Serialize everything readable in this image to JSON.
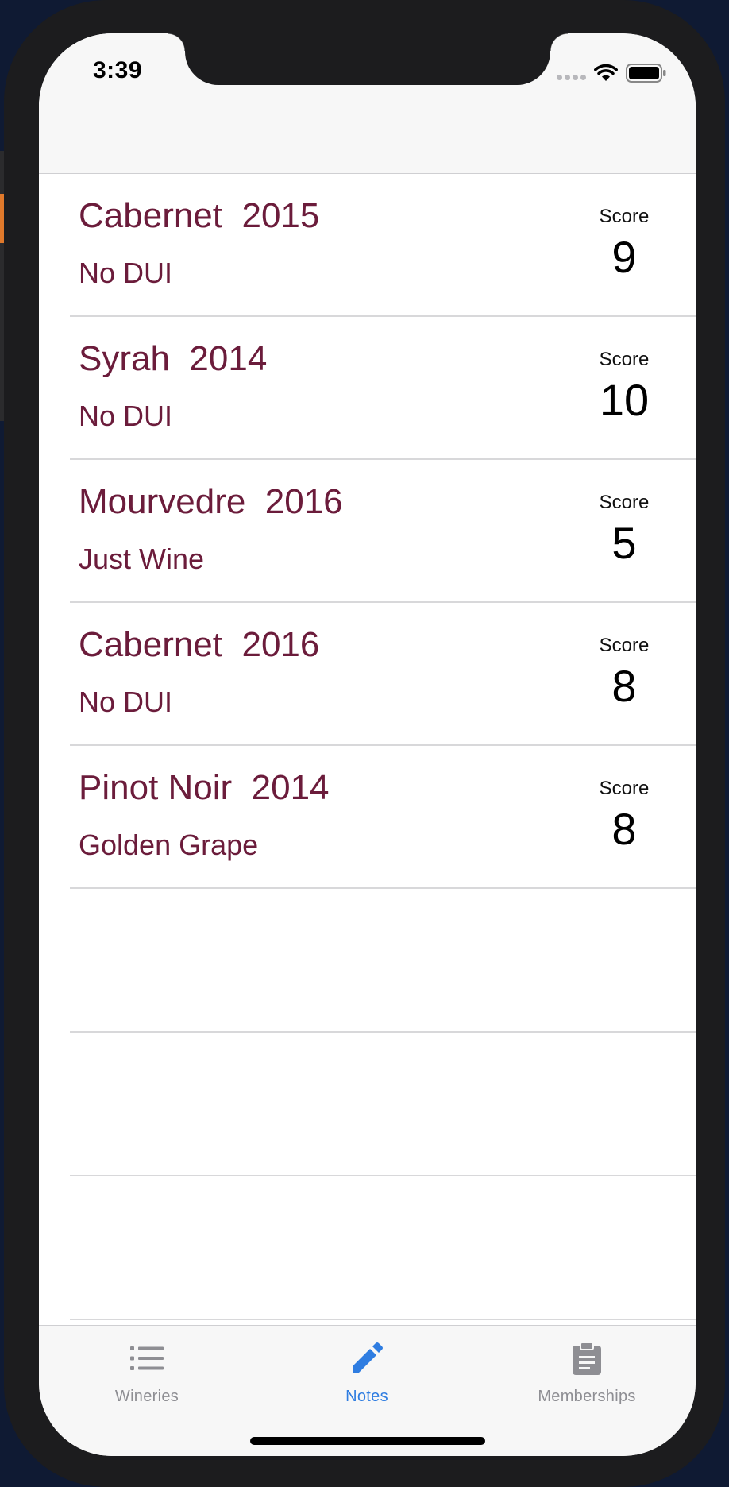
{
  "status": {
    "time": "3:39"
  },
  "entries": [
    {
      "wine": "Cabernet",
      "year": "2015",
      "winery": "No DUI",
      "score_label": "Score",
      "score": "9"
    },
    {
      "wine": "Syrah",
      "year": "2014",
      "winery": "No DUI",
      "score_label": "Score",
      "score": "10"
    },
    {
      "wine": "Mourvedre",
      "year": "2016",
      "winery": "Just Wine",
      "score_label": "Score",
      "score": "5"
    },
    {
      "wine": "Cabernet",
      "year": "2016",
      "winery": "No DUI",
      "score_label": "Score",
      "score": "8"
    },
    {
      "wine": "Pinot Noir",
      "year": "2014",
      "winery": "Golden Grape",
      "score_label": "Score",
      "score": "8"
    }
  ],
  "tabs": [
    {
      "label": "Wineries",
      "icon": "list-icon",
      "active": false
    },
    {
      "label": "Notes",
      "icon": "pencil-icon",
      "active": true
    },
    {
      "label": "Memberships",
      "icon": "clipboard-icon",
      "active": false
    }
  ],
  "colors": {
    "text_accent": "#6b1c3b",
    "tab_active": "#2f7de1",
    "tab_inactive": "#8e8e93"
  }
}
